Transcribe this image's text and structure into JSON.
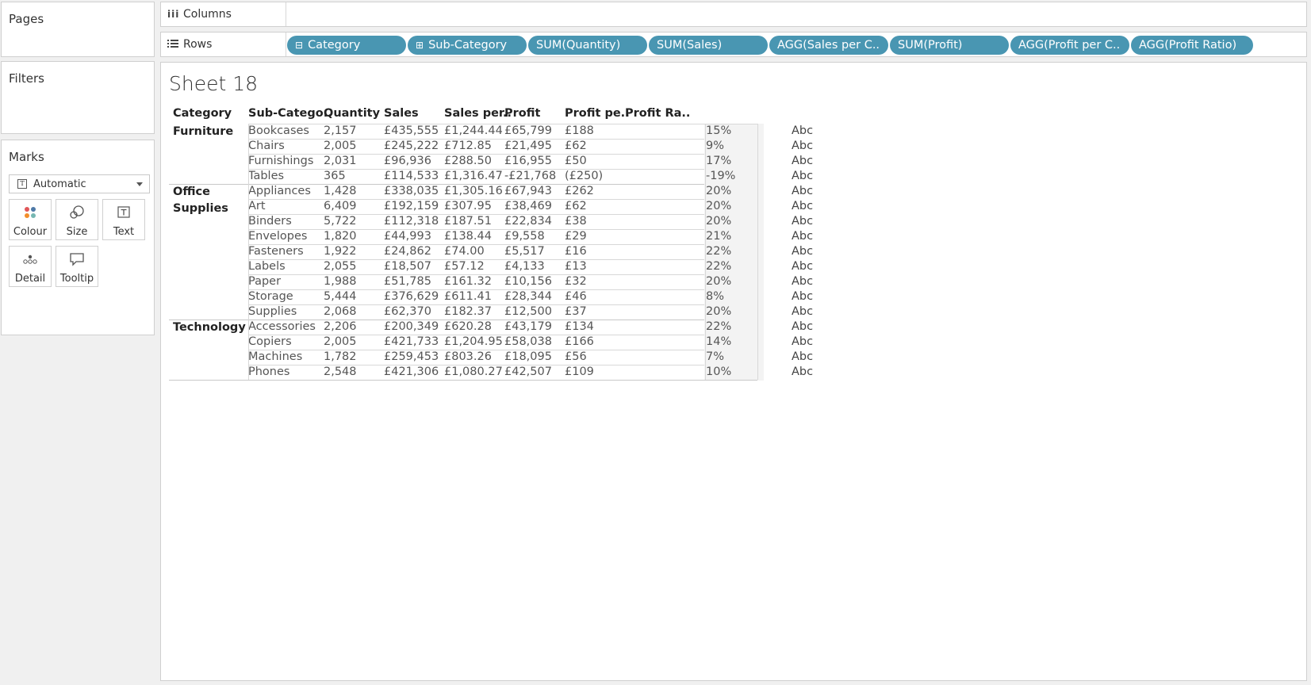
{
  "left_panels": {
    "pages": {
      "title": "Pages"
    },
    "filters": {
      "title": "Filters"
    },
    "marks": {
      "title": "Marks",
      "mark_type": "Automatic",
      "buttons": [
        {
          "label": "Colour",
          "icon": "colour-dots-icon"
        },
        {
          "label": "Size",
          "icon": "size-circles-icon"
        },
        {
          "label": "Text",
          "icon": "text-t-icon"
        },
        {
          "label": "Detail",
          "icon": "detail-dots-icon"
        },
        {
          "label": "Tooltip",
          "icon": "tooltip-bubble-icon"
        }
      ]
    }
  },
  "shelves": {
    "columns": {
      "label": "Columns",
      "icon": "iii"
    },
    "rows": {
      "label": "Rows",
      "icon": "list-lines-icon",
      "pills": [
        {
          "label": "Category",
          "prefix": "⊟"
        },
        {
          "label": "Sub-Category",
          "prefix": "⊞"
        },
        {
          "label": "SUM(Quantity)",
          "prefix": ""
        },
        {
          "label": "SUM(Sales)",
          "prefix": ""
        },
        {
          "label": "AGG(Sales per C..",
          "prefix": ""
        },
        {
          "label": "SUM(Profit)",
          "prefix": ""
        },
        {
          "label": "AGG(Profit per C..",
          "prefix": ""
        },
        {
          "label": "AGG(Profit Ratio)",
          "prefix": ""
        }
      ]
    }
  },
  "sheet": {
    "title": "Sheet 18",
    "headers": [
      "Category",
      "Sub-Catego..",
      "Quantity",
      "Sales",
      "Sales per..",
      "Profit",
      "Profit pe..",
      "Profit Ra.."
    ],
    "abc_label": "Abc",
    "categories": [
      {
        "name_line1": "Furniture",
        "name_line2": "",
        "rows": [
          [
            "Bookcases",
            "2,157",
            "£435,555",
            "£1,244.44",
            "£65,799",
            "£188",
            "15%"
          ],
          [
            "Chairs",
            "2,005",
            "£245,222",
            "£712.85",
            "£21,495",
            "£62",
            "9%"
          ],
          [
            "Furnishings",
            "2,031",
            "£96,936",
            "£288.50",
            "£16,955",
            "£50",
            "17%"
          ],
          [
            "Tables",
            "365",
            "£114,533",
            "£1,316.47",
            "-£21,768",
            "(£250)",
            "-19%"
          ]
        ]
      },
      {
        "name_line1": "Office",
        "name_line2": "Supplies",
        "rows": [
          [
            "Appliances",
            "1,428",
            "£338,035",
            "£1,305.16",
            "£67,943",
            "£262",
            "20%"
          ],
          [
            "Art",
            "6,409",
            "£192,159",
            "£307.95",
            "£38,469",
            "£62",
            "20%"
          ],
          [
            "Binders",
            "5,722",
            "£112,318",
            "£187.51",
            "£22,834",
            "£38",
            "20%"
          ],
          [
            "Envelopes",
            "1,820",
            "£44,993",
            "£138.44",
            "£9,558",
            "£29",
            "21%"
          ],
          [
            "Fasteners",
            "1,922",
            "£24,862",
            "£74.00",
            "£5,517",
            "£16",
            "22%"
          ],
          [
            "Labels",
            "2,055",
            "£18,507",
            "£57.12",
            "£4,133",
            "£13",
            "22%"
          ],
          [
            "Paper",
            "1,988",
            "£51,785",
            "£161.32",
            "£10,156",
            "£32",
            "20%"
          ],
          [
            "Storage",
            "5,444",
            "£376,629",
            "£611.41",
            "£28,344",
            "£46",
            "8%"
          ],
          [
            "Supplies",
            "2,068",
            "£62,370",
            "£182.37",
            "£12,500",
            "£37",
            "20%"
          ]
        ]
      },
      {
        "name_line1": "Technology",
        "name_line2": "",
        "rows": [
          [
            "Accessories",
            "2,206",
            "£200,349",
            "£620.28",
            "£43,179",
            "£134",
            "22%"
          ],
          [
            "Copiers",
            "2,005",
            "£421,733",
            "£1,204.95",
            "£58,038",
            "£166",
            "14%"
          ],
          [
            "Machines",
            "1,782",
            "£259,453",
            "£803.26",
            "£18,095",
            "£56",
            "7%"
          ],
          [
            "Phones",
            "2,548",
            "£421,306",
            "£1,080.27",
            "£42,507",
            "£109",
            "10%"
          ]
        ]
      }
    ]
  }
}
